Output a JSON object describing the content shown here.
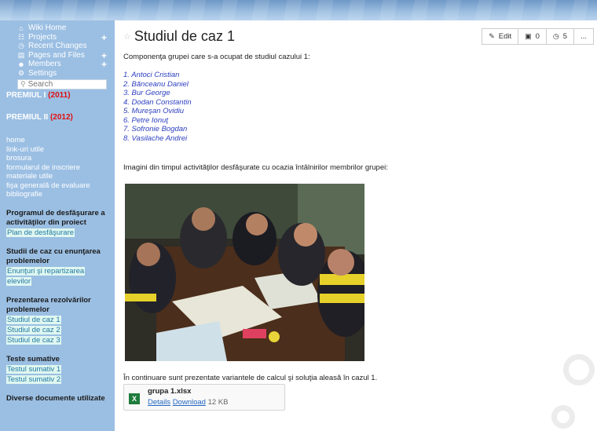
{
  "sidebar": {
    "nav": [
      {
        "label": "Wiki Home",
        "icon": "home-icon",
        "plus": false
      },
      {
        "label": "Projects",
        "icon": "sitemap-icon",
        "plus": true
      },
      {
        "label": "Recent Changes",
        "icon": "clock-icon",
        "plus": false
      },
      {
        "label": "Pages and Files",
        "icon": "file-icon",
        "plus": true
      },
      {
        "label": "Members",
        "icon": "user-icon",
        "plus": true
      },
      {
        "label": "Settings",
        "icon": "gear-icon",
        "plus": false
      }
    ],
    "plus_symbol": "+",
    "search_placeholder": "Search",
    "premiu1": {
      "label": "PREMIUL I",
      "year": "(2011)"
    },
    "premiu2": {
      "label": "PREMIUL II",
      "year": "(2012)"
    },
    "links": [
      "home",
      "link-uri utile",
      "brosura",
      "formularul de inscriere",
      "materiale utile",
      "fişa generală de evaluare",
      "bibliografie"
    ],
    "section1": {
      "heading": [
        "Programul de desfăşurare a",
        "activităţilor din proiect"
      ],
      "items": [
        "Plan de desfăşurare"
      ]
    },
    "section2": {
      "heading": [
        "Studii de caz cu enunţarea",
        "problemelor"
      ],
      "items": [
        "Enunţuri şi repartizarea",
        "elevilor"
      ]
    },
    "section3": {
      "heading": [
        "Prezentarea rezolvărilor",
        "problemelor"
      ],
      "items": [
        "Studiul de caz 1",
        "Studiul de caz 2",
        "Studiul de caz 3"
      ]
    },
    "section4": {
      "heading": [
        "Teste sumative"
      ],
      "items": [
        "Testul sumativ 1",
        "Testul sumativ 2"
      ]
    },
    "section5": {
      "heading": [
        "Diverse documente utilizate"
      ]
    }
  },
  "page": {
    "title": "Studiul de caz 1",
    "actions": {
      "edit": "Edit",
      "comments": "0",
      "history": "5",
      "more": "..."
    },
    "intro": "Componenţa grupei care s-a ocupat de studiul cazului 1:",
    "members": [
      "1. Antoci Cristian",
      "2. Bănceanu Daniel",
      "3. Bur George",
      "4. Dodan Constantin",
      "5. Mureşan Ovidiu",
      "6. Petre Ionuţ",
      "7. Sofronie Bogdan",
      "8. Vasilache Andrei"
    ],
    "images_caption": "Imagini din timpul activităţilor desfăşurate cu ocazia întâlnirilor membrilor grupei:",
    "continuation": "În continuare sunt prezentate variantele de calcul şi soluţia aleasă în cazul 1.",
    "attachment": {
      "name": "grupa 1.xlsx",
      "details": "Details",
      "download": "Download",
      "size": "12 KB",
      "icon_letter": "X"
    }
  }
}
